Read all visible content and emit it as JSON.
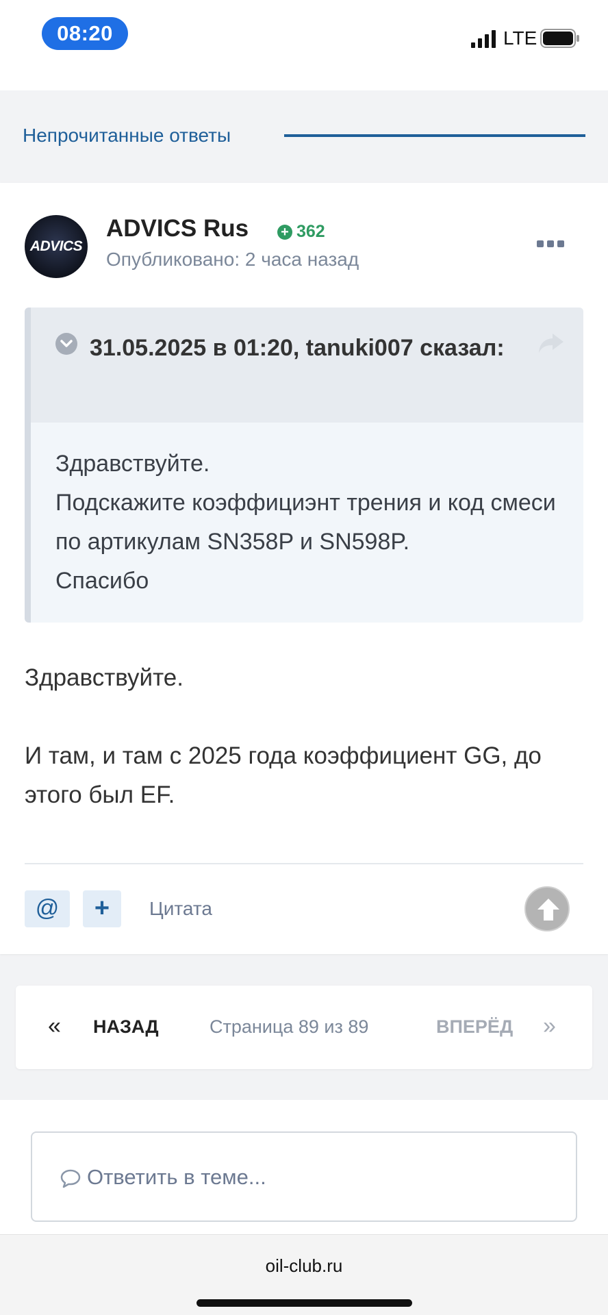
{
  "status_bar": {
    "time": "08:20",
    "network": "LTE"
  },
  "section": {
    "title": "Непрочитанные ответы"
  },
  "post": {
    "avatar_text": "ADVICS",
    "author": "ADVICS Rus",
    "reputation": "362",
    "published": "Опубликовано: 2 часа назад",
    "quote": {
      "citation": "31.05.2025 в 01:20, tanuki007 сказал:",
      "lines": [
        "Здравствуйте.",
        "Подскажите коэффициэнт трения и код смеси по артикулам SN358P и SN598P.",
        "Спасибо"
      ]
    },
    "reply": {
      "greeting": "Здравствуйте.",
      "body": "И там, и там с 2025 года коэффициент GG, до этого был EF."
    },
    "actions": {
      "mention": "@",
      "plus": "+",
      "quote": "Цитата"
    }
  },
  "pagination": {
    "prev_arrow": "«",
    "prev": "НАЗАД",
    "info": "Страница 89 из 89",
    "next": "ВПЕРЁД",
    "next_arrow": "»"
  },
  "reply_box": {
    "placeholder": "Ответить в теме..."
  },
  "browser": {
    "url": "oil-club.ru"
  },
  "colors": {
    "accent": "#1f5f99",
    "reputation": "#2f9b62",
    "status_pill": "#1f6fe5"
  },
  "icons": [
    "signal-icon",
    "battery-icon",
    "chevron-down-icon",
    "share-icon",
    "ellipsis-icon",
    "arrow-up-icon",
    "speech-bubble-icon"
  ]
}
